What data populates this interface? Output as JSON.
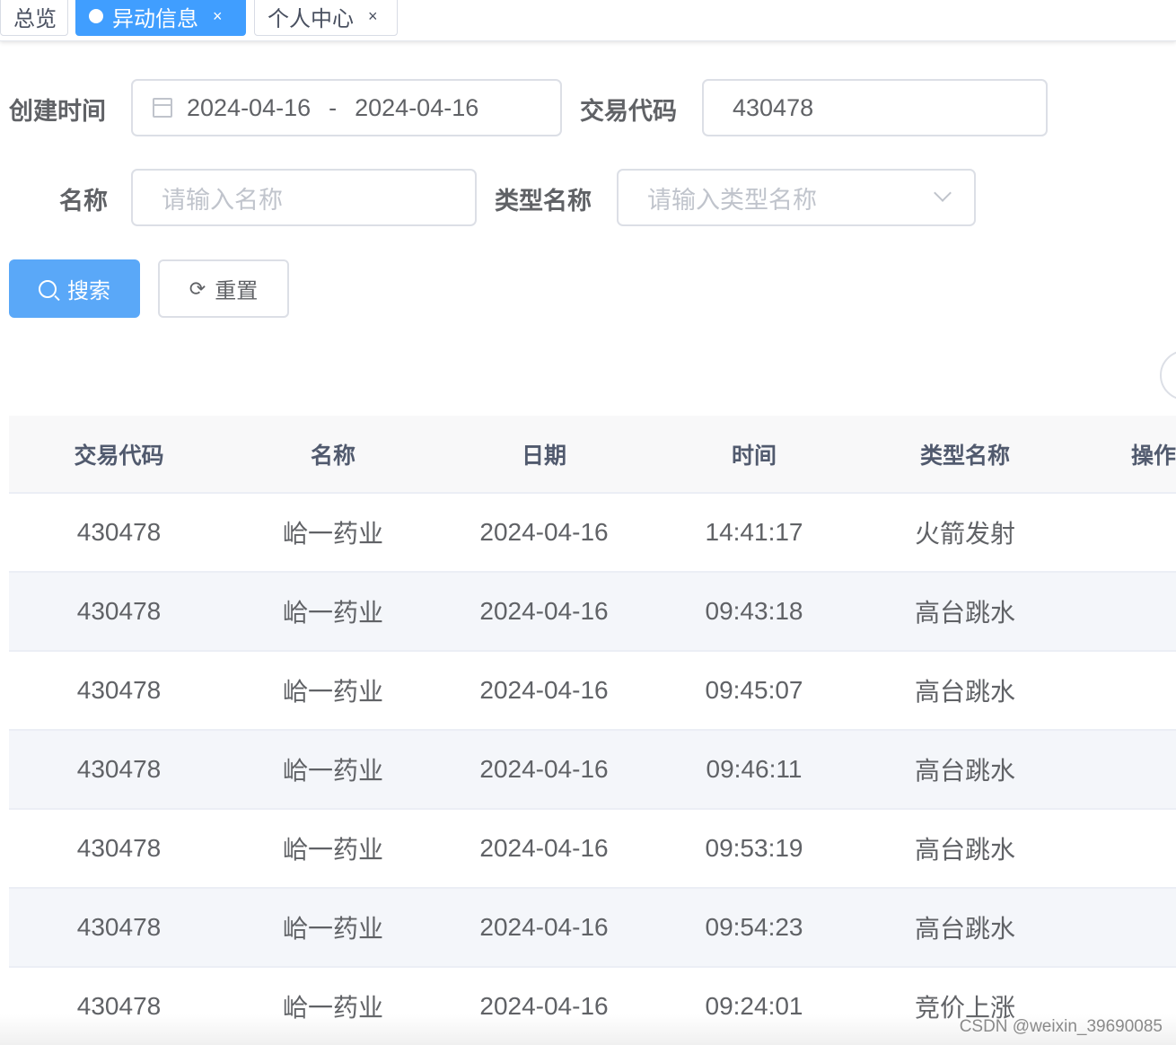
{
  "tags": [
    {
      "label": "总览",
      "closable": false,
      "active": false
    },
    {
      "label": "异动信息",
      "closable": true,
      "active": true
    },
    {
      "label": "个人中心",
      "closable": true,
      "active": false
    }
  ],
  "tag_close_glyph": "×",
  "form": {
    "created_time_label": "创建时间",
    "date_start": "2024-04-16",
    "date_separator": "-",
    "date_end": "2024-04-16",
    "trade_code_label": "交易代码",
    "trade_code_value": "430478",
    "name_label": "名称",
    "name_placeholder": "请输入名称",
    "type_name_label": "类型名称",
    "type_name_placeholder": "请输入类型名称",
    "search_button": "搜索",
    "reset_button": "重置"
  },
  "table": {
    "headers": [
      "交易代码",
      "名称",
      "日期",
      "时间",
      "类型名称",
      "操作"
    ],
    "rows": [
      [
        "430478",
        "峆一药业",
        "2024-04-16",
        "14:41:17",
        "火箭发射"
      ],
      [
        "430478",
        "峆一药业",
        "2024-04-16",
        "09:43:18",
        "高台跳水"
      ],
      [
        "430478",
        "峆一药业",
        "2024-04-16",
        "09:45:07",
        "高台跳水"
      ],
      [
        "430478",
        "峆一药业",
        "2024-04-16",
        "09:46:11",
        "高台跳水"
      ],
      [
        "430478",
        "峆一药业",
        "2024-04-16",
        "09:53:19",
        "高台跳水"
      ],
      [
        "430478",
        "峆一药业",
        "2024-04-16",
        "09:54:23",
        "高台跳水"
      ],
      [
        "430478",
        "峆一药业",
        "2024-04-16",
        "09:24:01",
        "竞价上涨"
      ]
    ]
  },
  "watermark": "CSDN @weixin_39690085",
  "colors": {
    "primary": "#409eff",
    "button_primary": "#5aa8f8",
    "stripe": "#f4f6fa",
    "border": "#dcdfe6"
  }
}
